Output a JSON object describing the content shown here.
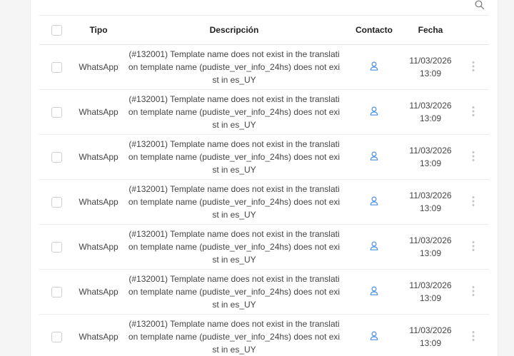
{
  "header": {
    "col_tipo": "Tipo",
    "col_descripcion": "Descripción",
    "col_contacto": "Contacto",
    "col_fecha": "Fecha"
  },
  "icons": {
    "search": "search-icon",
    "contact": "user-icon",
    "row_menu": "more-vertical-icon"
  },
  "colors": {
    "accent": "#4a8fe7",
    "kebab": "#c4c4c4"
  },
  "rows": [
    {
      "tipo": "WhatsApp",
      "descripcion": "(#132001) Template name does not exist in the translation template name (pudiste_ver_info_24hs) does not exist in es_UY",
      "fecha_date": "11/03/2026",
      "fecha_time": "13:09"
    },
    {
      "tipo": "WhatsApp",
      "descripcion": "(#132001) Template name does not exist in the translation template name (pudiste_ver_info_24hs) does not exist in es_UY",
      "fecha_date": "11/03/2026",
      "fecha_time": "13:09"
    },
    {
      "tipo": "WhatsApp",
      "descripcion": "(#132001) Template name does not exist in the translation template name (pudiste_ver_info_24hs) does not exist in es_UY",
      "fecha_date": "11/03/2026",
      "fecha_time": "13:09"
    },
    {
      "tipo": "WhatsApp",
      "descripcion": "(#132001) Template name does not exist in the translation template name (pudiste_ver_info_24hs) does not exist in es_UY",
      "fecha_date": "11/03/2026",
      "fecha_time": "13:09"
    },
    {
      "tipo": "WhatsApp",
      "descripcion": "(#132001) Template name does not exist in the translation template name (pudiste_ver_info_24hs) does not exist in es_UY",
      "fecha_date": "11/03/2026",
      "fecha_time": "13:09"
    },
    {
      "tipo": "WhatsApp",
      "descripcion": "(#132001) Template name does not exist in the translation template name (pudiste_ver_info_24hs) does not exist in es_UY",
      "fecha_date": "11/03/2026",
      "fecha_time": "13:09"
    },
    {
      "tipo": "WhatsApp",
      "descripcion": "(#132001) Template name does not exist in the translation template name (pudiste_ver_info_24hs) does not exist in es_UY",
      "fecha_date": "11/03/2026",
      "fecha_time": "13:09"
    }
  ]
}
